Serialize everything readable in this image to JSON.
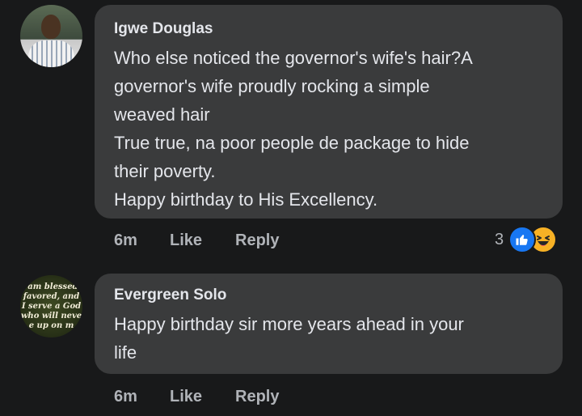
{
  "comments": [
    {
      "author": "Igwe Douglas",
      "lines": [
        "Who else noticed the governor's wife's hair?A",
        "governor's wife proudly rocking a simple",
        "weaved hair",
        "True true, na poor people de package to hide",
        "their poverty.",
        "Happy birthday to His Excellency."
      ],
      "time": "6m",
      "like_label": "Like",
      "reply_label": "Reply",
      "reaction_count": "3",
      "reactions": [
        "like-icon",
        "haha-icon"
      ]
    },
    {
      "author": "Evergreen Solo",
      "avatar_text": [
        "i am blessed,",
        "favored, and",
        "I serve a God",
        "who will neve",
        "e up on m"
      ],
      "lines": [
        "Happy birthday sir more years ahead in your",
        "life"
      ],
      "time": "6m",
      "like_label": "Like",
      "reply_label": "Reply"
    }
  ],
  "colors": {
    "background": "#18191a",
    "bubble": "#3a3b3c",
    "text": "#e4e6eb",
    "secondary": "#b0b3b8",
    "like_blue": "#1877f2",
    "haha_yellow": "#f7b125"
  }
}
